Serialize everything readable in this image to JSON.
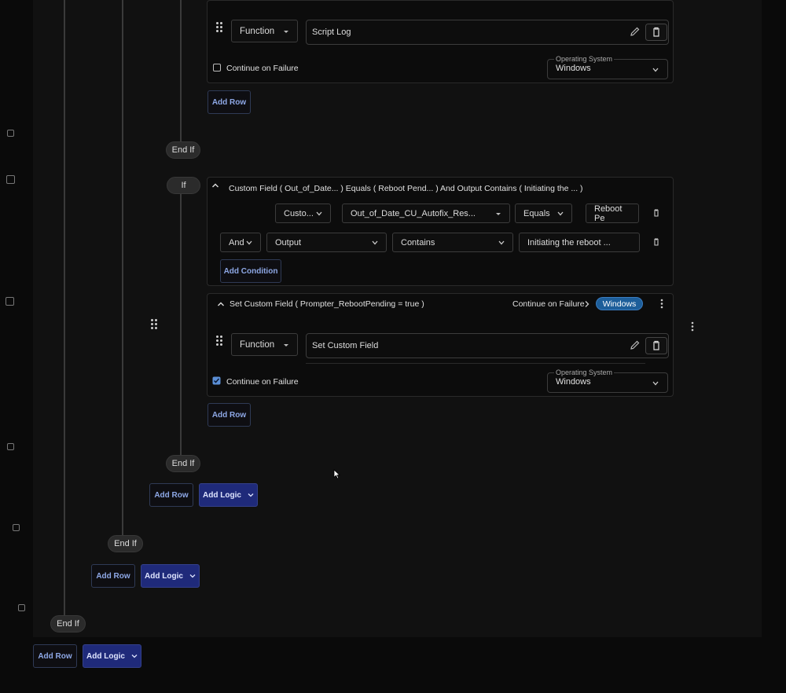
{
  "function_label": "Function",
  "block1": {
    "name_value": "Script Log",
    "continue_on_failure": "Continue on Failure",
    "os_label": "Operating System",
    "os_value": "Windows",
    "add_row": "Add Row"
  },
  "end_if": "End If",
  "if_label": "If",
  "condition": {
    "summary": "Custom Field ( Out_of_Date... ) Equals ( Reboot Pend... ) And Output Contains ( Initiating the ... )",
    "row1": {
      "type": "Custo...",
      "field": "Out_of_Date_CU_Autofix_Res...",
      "operator": "Equals",
      "value": "Reboot Pe"
    },
    "row2": {
      "conjunction": "And",
      "type": "Output",
      "operator": "Contains",
      "value": "Initiating the reboot ..."
    },
    "add_condition": "Add Condition"
  },
  "block2": {
    "summary": "Set Custom Field ( Prompter_RebootPending = true )",
    "continue_on_failure_link": "Continue on Failure",
    "os_badge": "Windows",
    "name_value": "Set Custom Field",
    "continue_on_failure": "Continue on Failure",
    "os_label": "Operating System",
    "os_value": "Windows",
    "add_row": "Add Row"
  },
  "footer": {
    "add_row": "Add Row",
    "add_logic": "Add Logic"
  },
  "colors": {
    "accent": "#1f2a7a",
    "badge": "#1d5e9a",
    "checkbox_checked": "#5b8fd6"
  }
}
